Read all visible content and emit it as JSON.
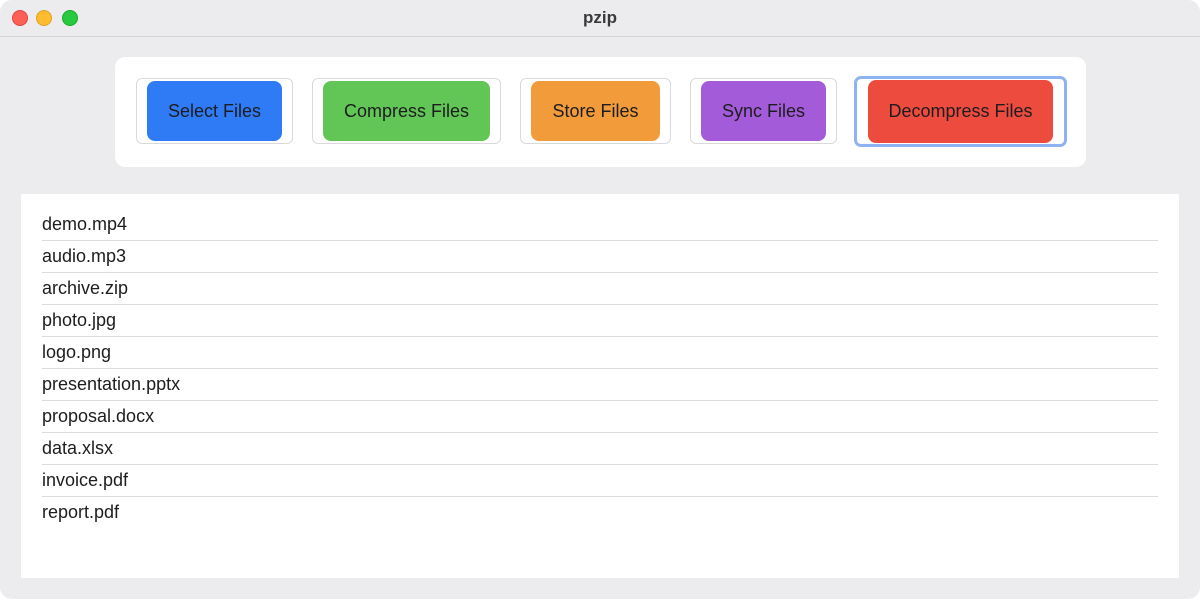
{
  "window": {
    "title": "pzip"
  },
  "toolbar": {
    "buttons": [
      {
        "label": "Select Files",
        "color": "#2f7bf5"
      },
      {
        "label": "Compress Files",
        "color": "#62c656"
      },
      {
        "label": "Store Files",
        "color": "#f29b3a"
      },
      {
        "label": "Sync Files",
        "color": "#a35bd9"
      },
      {
        "label": "Decompress Files",
        "color": "#ee4b3f"
      }
    ]
  },
  "files": [
    "demo.mp4",
    "audio.mp3",
    "archive.zip",
    "photo.jpg",
    "logo.png",
    "presentation.pptx",
    "proposal.docx",
    "data.xlsx",
    "invoice.pdf",
    "report.pdf"
  ]
}
